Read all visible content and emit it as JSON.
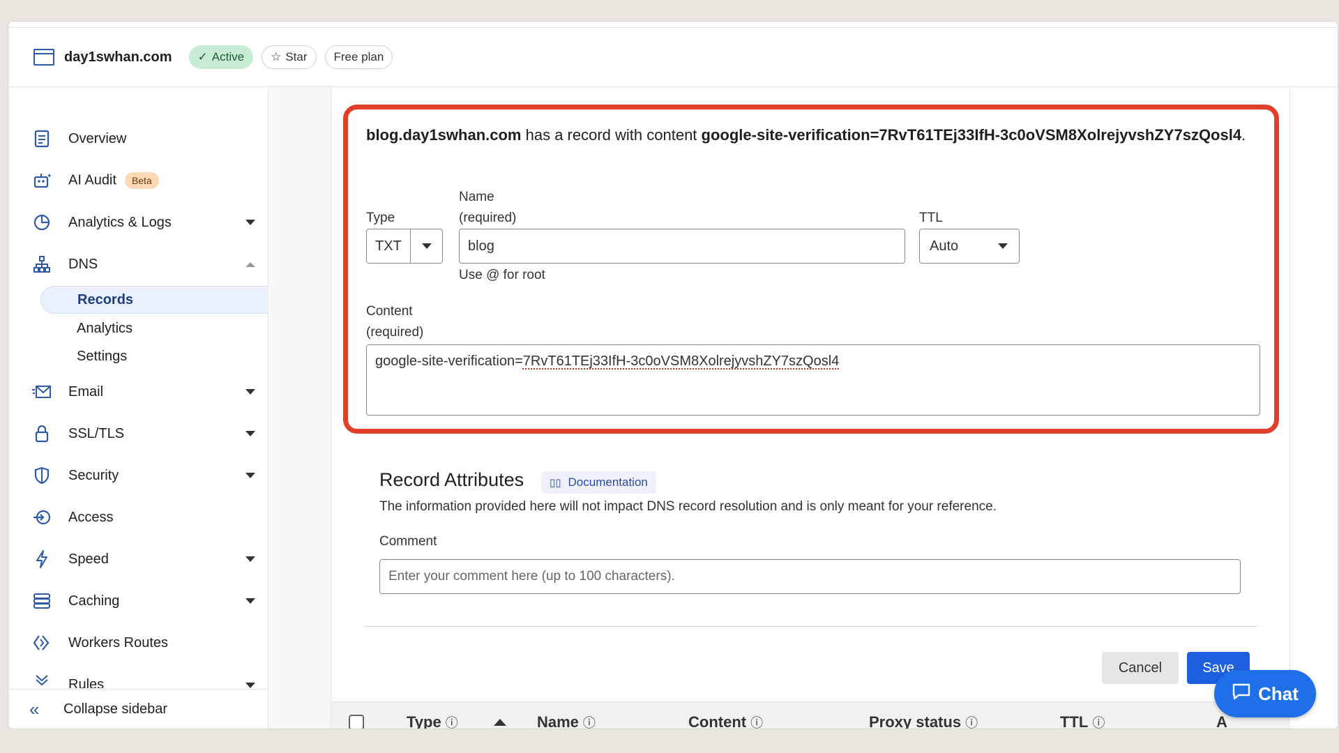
{
  "header": {
    "domain": "day1swhan.com",
    "status_label": "Active",
    "star_label": "Star",
    "plan_label": "Free plan"
  },
  "sidebar": {
    "items": [
      {
        "label": "Overview",
        "icon": "document-icon"
      },
      {
        "label": "AI Audit",
        "icon": "robot-icon",
        "badge": "Beta"
      },
      {
        "label": "Analytics & Logs",
        "icon": "pie-chart-icon"
      },
      {
        "label": "DNS",
        "icon": "network-icon"
      },
      {
        "label": "Email",
        "icon": "email-icon"
      },
      {
        "label": "SSL/TLS",
        "icon": "lock-icon"
      },
      {
        "label": "Security",
        "icon": "shield-icon"
      },
      {
        "label": "Access",
        "icon": "access-icon"
      },
      {
        "label": "Speed",
        "icon": "lightning-icon"
      },
      {
        "label": "Caching",
        "icon": "server-icon"
      },
      {
        "label": "Workers Routes",
        "icon": "workers-icon"
      },
      {
        "label": "Rules",
        "icon": "rules-icon"
      }
    ],
    "dns_sub": [
      "Records",
      "Analytics",
      "Settings"
    ],
    "collapse_label": "Collapse sidebar"
  },
  "form": {
    "msg_host": "blog.day1swhan.com",
    "msg_mid": " has a record with content ",
    "msg_content": "google-site-verification=7RvT61TEj33IfH-3c0oVSM8XolrejyvshZY7szQosl4",
    "msg_end": ".",
    "type_label": "Type",
    "type_value": "TXT",
    "name_label": "Name",
    "name_required": "(required)",
    "name_value": "blog",
    "name_hint": "Use @ for root",
    "ttl_label": "TTL",
    "ttl_value": "Auto",
    "content_label": "Content",
    "content_required": "(required)",
    "content_prefix": "google-site-verification=",
    "content_token": "7RvT61TEj33IfH-3c0oVSM8XolrejyvshZY7szQosl4"
  },
  "attributes": {
    "title": "Record Attributes",
    "doc_label": "Documentation",
    "description": "The information provided here will not impact DNS record resolution and is only meant for your reference.",
    "comment_label": "Comment",
    "comment_placeholder": "Enter your comment here (up to 100 characters)."
  },
  "actions": {
    "cancel_label": "Cancel",
    "save_label": "Save"
  },
  "table": {
    "columns": [
      "Type",
      "Name",
      "Content",
      "Proxy status",
      "TTL",
      "A"
    ]
  },
  "chat": {
    "label": "Chat"
  },
  "colors": {
    "accent": "#1e5fe0",
    "highlight": "#e0402a",
    "active_badge": "#c7ecd3"
  }
}
